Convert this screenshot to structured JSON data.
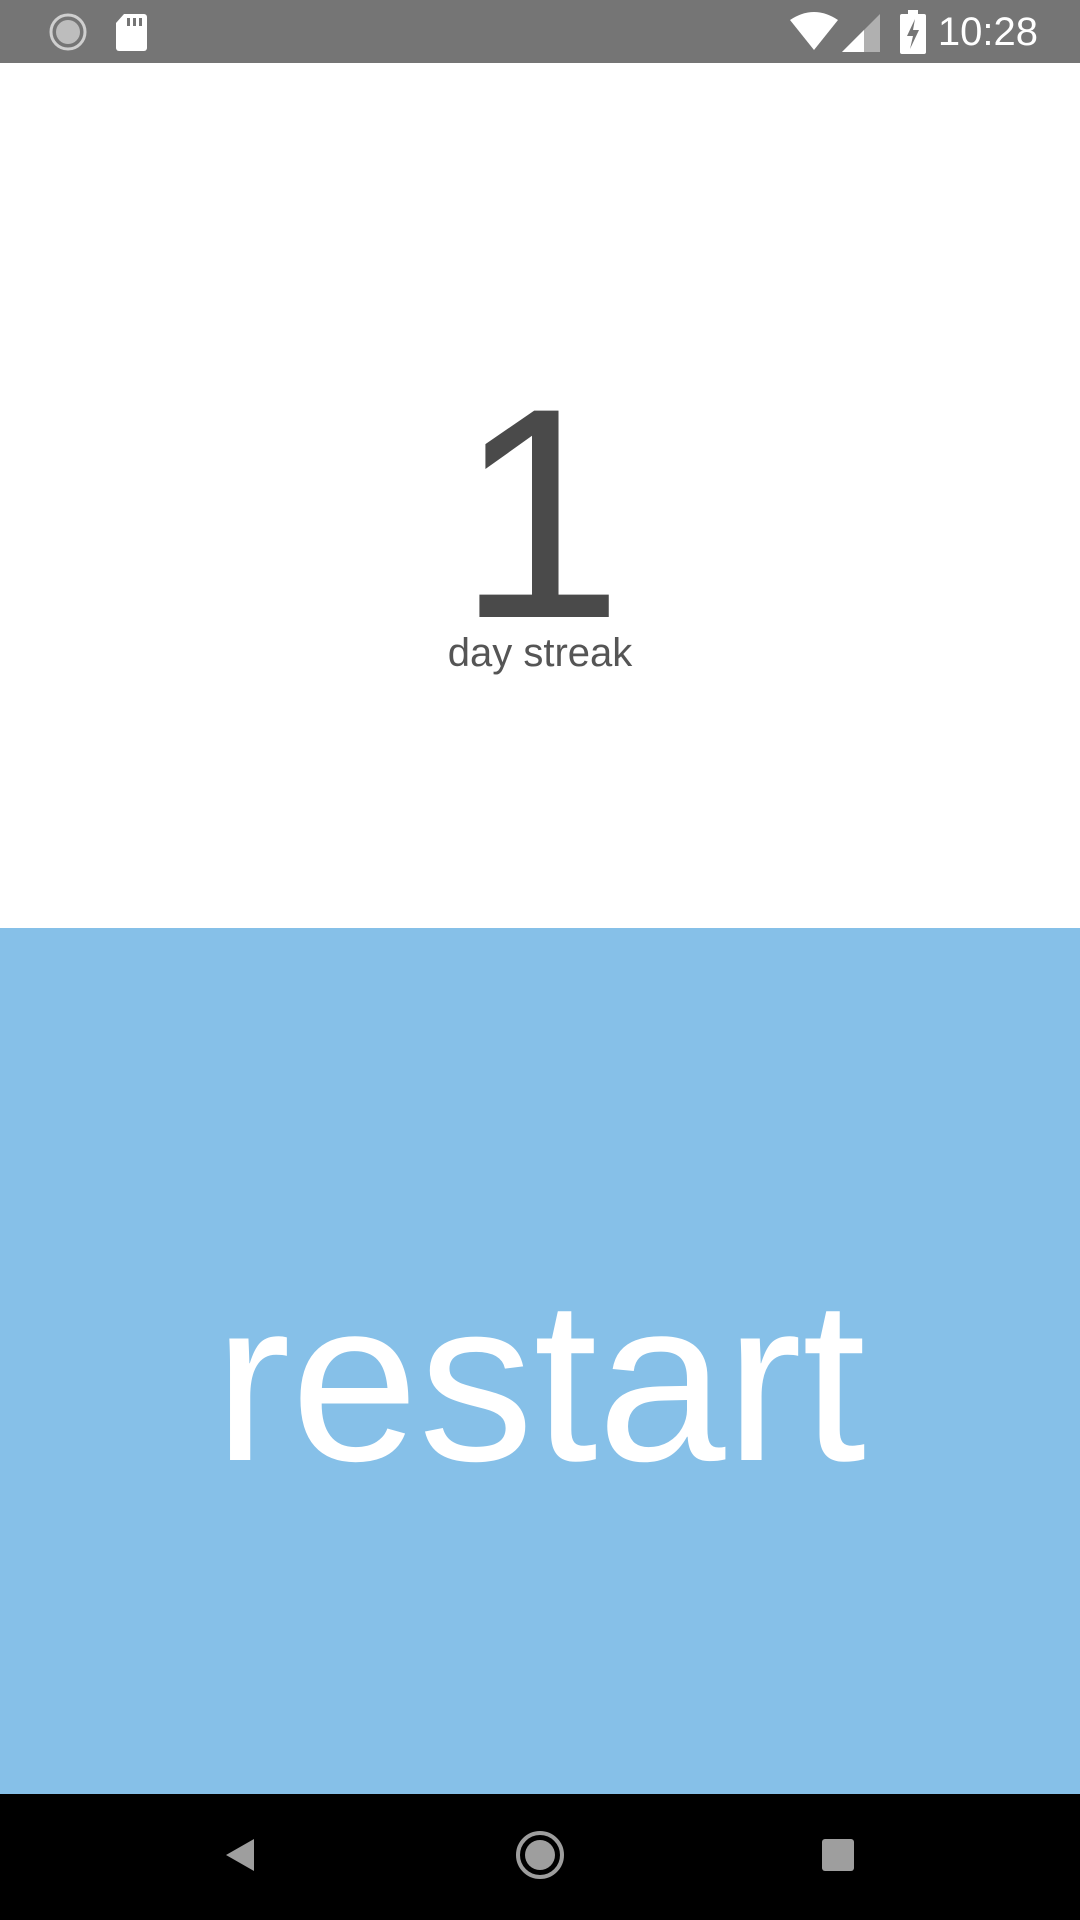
{
  "status_bar": {
    "time": "10:28",
    "icons": [
      "sync-icon",
      "sd-card-icon",
      "wifi-icon",
      "cell-signal-icon",
      "battery-charging-icon"
    ],
    "background": "#757575"
  },
  "streak": {
    "count": "1",
    "label": "day streak",
    "text_color": "#4a4a4a"
  },
  "restart": {
    "label": "restart",
    "background": "#86c0e8"
  },
  "nav_bar": {
    "buttons": [
      "back-icon",
      "home-icon",
      "recents-icon"
    ]
  }
}
